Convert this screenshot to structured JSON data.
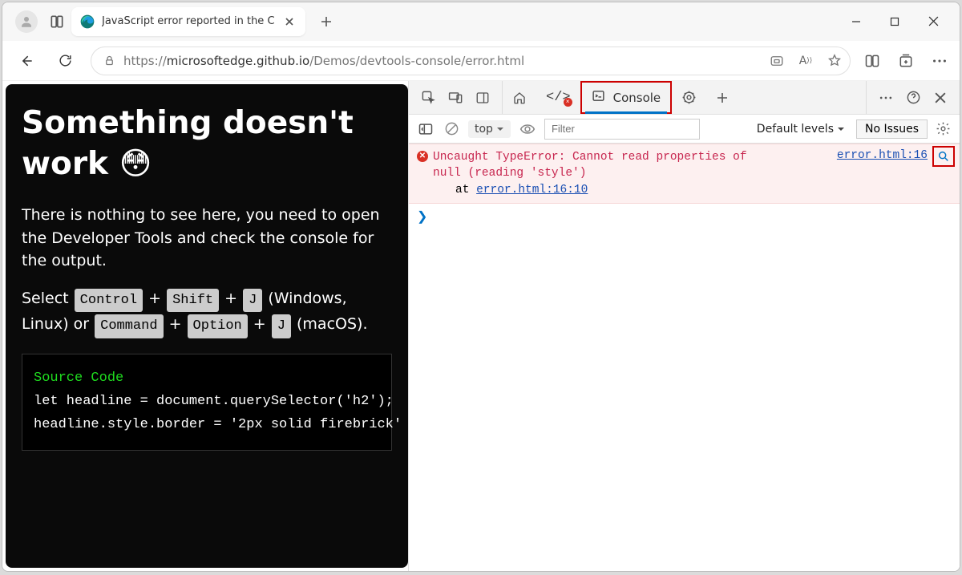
{
  "browser": {
    "tab_title": "JavaScript error reported in the C",
    "url_prefix": "https://",
    "url_domain": "microsoftedge.github.io",
    "url_path": "/Demos/devtools-console/error.html"
  },
  "page": {
    "heading": "Something doesn't work 😳",
    "para1": "There is nothing to see here, you need to open the Developer Tools and check the console for the output.",
    "select_word": "Select",
    "kbd_control": "Control",
    "plus": " + ",
    "kbd_shift": "Shift",
    "kbd_j": "J",
    "platforms1": " (Windows, Linux) or ",
    "kbd_command": "Command",
    "kbd_option": "Option",
    "platforms2": " (macOS).",
    "source_label": "Source Code",
    "code_line1": "let headline = document.querySelector('h2');",
    "code_line2": "headline.style.border = '2px solid firebrick'"
  },
  "devtools": {
    "tab_console": "Console",
    "context": "top",
    "filter_placeholder": "Filter",
    "levels": "Default levels",
    "no_issues": "No Issues"
  },
  "console_error": {
    "message_line1": "Uncaught TypeError: Cannot read properties of",
    "message_line2": "null (reading 'style')",
    "stack_prefix": "at ",
    "stack_link": "error.html:16:10",
    "source_link": "error.html:16"
  }
}
